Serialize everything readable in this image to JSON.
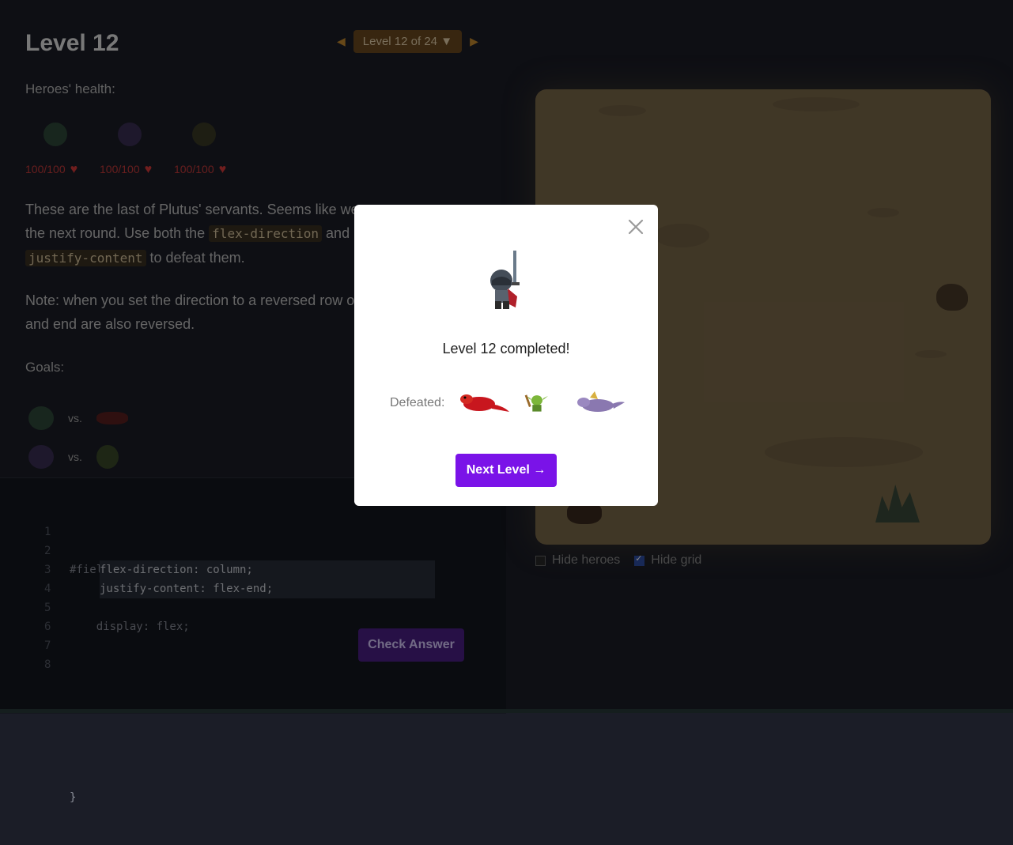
{
  "page": {
    "title": "Level 12",
    "level_selector": {
      "label": "Level 12 of 24",
      "prev_icon": "triangle-left",
      "next_icon": "triangle-right",
      "dropdown_icon": "triangle-down"
    }
  },
  "heroes": {
    "heading": "Heroes' health:",
    "items": [
      {
        "name": "knight",
        "health": "100/100"
      },
      {
        "name": "wizard",
        "health": "100/100"
      },
      {
        "name": "rogue",
        "health": "100/100"
      }
    ]
  },
  "story": {
    "para1_a": "These are the last of Plutus' servants. Seems like we",
    "para1_b": "the next round. Use both the",
    "code1": "flex-direction",
    "para1_c": "and",
    "code2": "justify-content",
    "para1_d": "to defeat them.",
    "para2_a": "Note: when you set the direction to a reversed row o",
    "para2_b": "and end are also reversed."
  },
  "goals": {
    "heading": "Goals:",
    "vs_label": "vs.",
    "rows": [
      {
        "hero": "knight",
        "enemy": "red-dragon"
      },
      {
        "hero": "wizard",
        "enemy": "goblin"
      }
    ]
  },
  "editor": {
    "line_numbers": [
      "1",
      "2",
      "3",
      "4",
      "5",
      "6",
      "7",
      "8"
    ],
    "line1": "#field {",
    "line2": "    display: flex;",
    "line5": "}",
    "input_value": "flex-direction: column;\njustify-content: flex-end;",
    "check_button": "Check Answer"
  },
  "board": {
    "hide_heroes": {
      "label": "Hide heroes",
      "checked": false
    },
    "hide_grid": {
      "label": "Hide grid",
      "checked": true
    },
    "colors": {
      "sand": "#7c6a4a"
    }
  },
  "modal": {
    "message": "Level 12 completed!",
    "defeated_label": "Defeated:",
    "defeated": [
      "red-lizard",
      "goblin",
      "purple-dragon"
    ],
    "next_button": "Next Level →",
    "close_icon": "close",
    "accent": "#7a13e8"
  }
}
